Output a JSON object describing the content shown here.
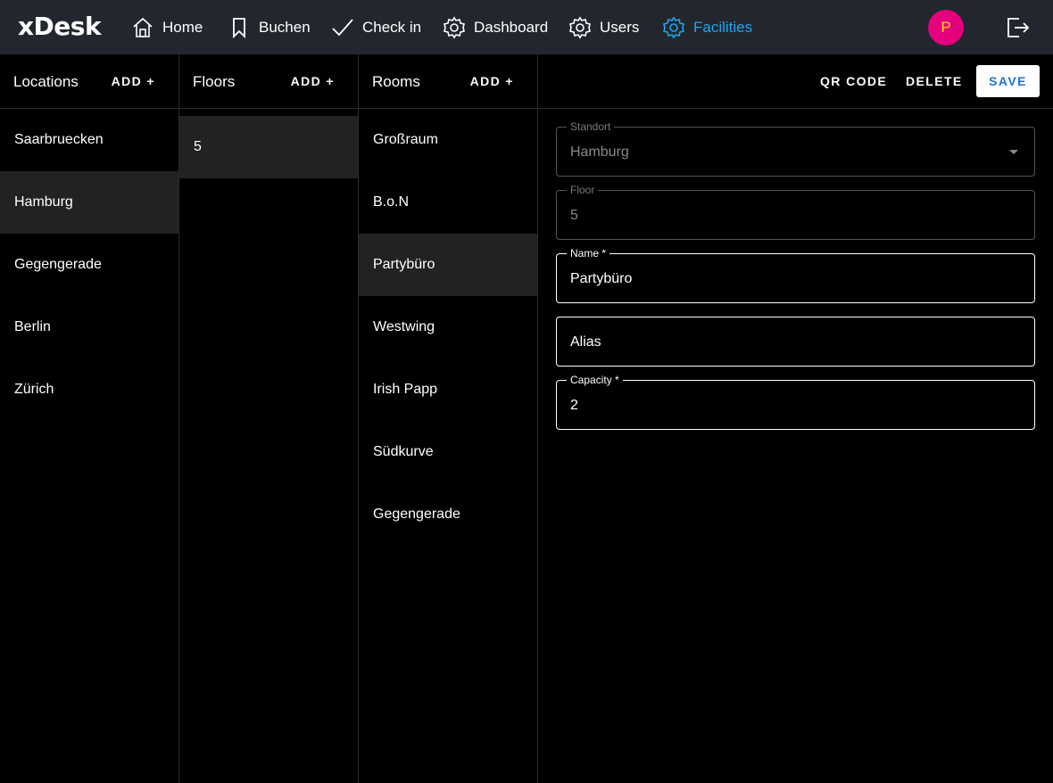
{
  "app": {
    "brand": "xDesk",
    "avatar_initial": "P",
    "accent_color": "#1ea5ef",
    "avatar_color": "#e5007d"
  },
  "nav": {
    "home": {
      "label": "Home",
      "icon": "home-icon"
    },
    "buchen": {
      "label": "Buchen",
      "icon": "bookmark-icon"
    },
    "checkin": {
      "label": "Check in",
      "icon": "checkmark-icon"
    },
    "dashboard": {
      "label": "Dashboard",
      "icon": "gear-icon"
    },
    "users": {
      "label": "Users",
      "icon": "gear-icon"
    },
    "facilities": {
      "label": "Facilities",
      "icon": "gear-icon",
      "active": true
    }
  },
  "locations": {
    "title": "Locations",
    "add_label": "ADD +",
    "items": [
      "Saarbruecken",
      "Hamburg",
      "Gegengerade",
      "Berlin",
      "Zürich"
    ],
    "selected": "Hamburg"
  },
  "floors": {
    "title": "Floors",
    "add_label": "ADD +",
    "items": [
      "5"
    ],
    "selected": "5"
  },
  "rooms": {
    "title": "Rooms",
    "add_label": "ADD +",
    "items": [
      "Großraum",
      "B.o.N",
      "Partybüro",
      "Westwing",
      "Irish Papp",
      "Südkurve",
      "Gegengerade"
    ],
    "selected": "Partybüro"
  },
  "detail": {
    "qr_label": "QR CODE",
    "delete_label": "DELETE",
    "save_label": "SAVE",
    "standort": {
      "label": "Standort",
      "value": "Hamburg"
    },
    "floor": {
      "label": "Floor",
      "value": "5"
    },
    "name": {
      "label": "Name *",
      "value": "Partybüro"
    },
    "alias": {
      "label": "",
      "placeholder": "Alias"
    },
    "capacity": {
      "label": "Capacity *",
      "value": "2"
    }
  }
}
